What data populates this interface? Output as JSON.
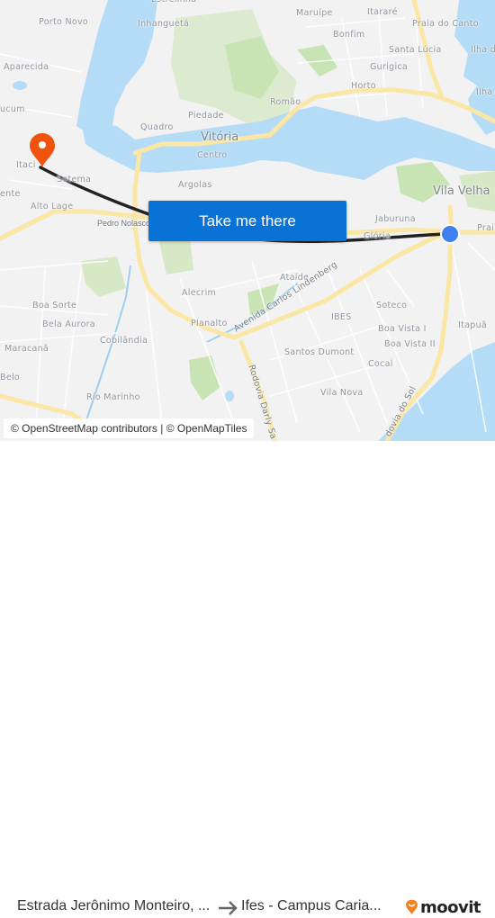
{
  "map": {
    "labels": {
      "estrelinha": "Estrelinha",
      "porto_novo": "Porto Novo",
      "inhangueta": "Inhanguetá",
      "maruipe": "Maruípe",
      "itarare": "Itararé",
      "praia_do_canto": "Praia do Canto",
      "bonfim": "Bonfim",
      "santa_lucia": "Santa Lúcia",
      "ilha_top": "Ilha d",
      "gurigica": "Gurigica",
      "aparecida": "Aparecida",
      "horto": "Horto",
      "ilha_mid": "Ilha",
      "romao": "Romão",
      "ucum": "ucum",
      "piedade": "Piedade",
      "quadro": "Quadro",
      "vitoria": "Vitória",
      "centro": "Centro",
      "itacibe": "Itaci",
      "sotema": "Sotema",
      "ente": "ente",
      "argolas": "Argolas",
      "vila_velha": "Vila Velha",
      "alto_lage": "Alto Lage",
      "pedro_nolasco": "Pedro Nolasco",
      "jaburuna": "Jaburuna",
      "praia_right": "Prai",
      "gloria": "Glória",
      "ataide": "Ataíde",
      "alecrim": "Alecrim",
      "boa_sorte": "Boa Sorte",
      "soteco": "Soteco",
      "bela_aurora": "Bela Aurora",
      "ibes": "IBES",
      "planalto": "Planalto",
      "boa_vista_1": "Boa Vista I",
      "itapua": "Itapuã",
      "maracana": "Maracanã",
      "cobilandia": "Cobilândia",
      "boa_vista_2": "Boa Vista II",
      "santos_dumont": "Santos Dumont",
      "cocal": "Cocal",
      "belo": "Belo",
      "vila_nova": "Vila Nova",
      "rio_marinho": "Rio Marinho",
      "av_carlos_lindenberg": "Avenida Carlos Lindenberg",
      "rodovia_darly": "Rodovia Darly Sa",
      "rodovia_sol": "dovia do Sol"
    },
    "markers": {
      "destination_icon": "map-pin-icon",
      "origin_icon": "current-location-dot-icon"
    },
    "colors": {
      "water": "#b4dcf7",
      "park": "#c9e4b4",
      "major_road": "#fbe7a5",
      "route": "#222222",
      "pin": "#f0530e",
      "origin_dot": "#3d7ff0"
    },
    "cta_label": "Take me there",
    "attribution": "© OpenStreetMap contributors | © OpenMapTiles"
  },
  "footer": {
    "origin": "Estrada Jerônimo Monteiro, ...",
    "arrow_icon": "arrow-right-icon",
    "destination": "Ifes - Campus Caria...",
    "brand": "moovit",
    "brand_icon": "moovit-logo-icon"
  }
}
